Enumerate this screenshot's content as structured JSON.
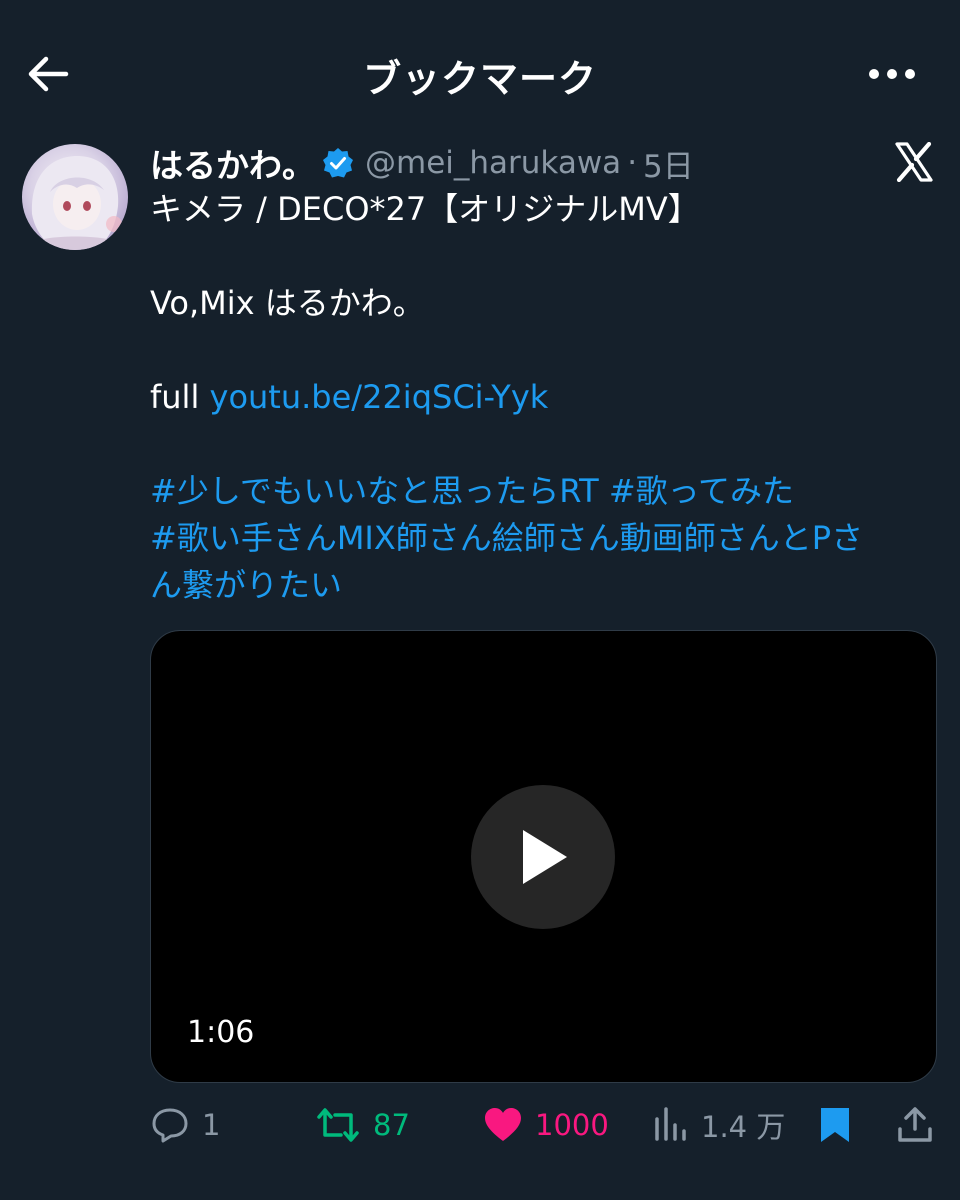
{
  "header": {
    "title": "ブックマーク"
  },
  "tweet": {
    "display_name": "はるかわ。",
    "handle": "@mei_harukawa",
    "separator": "·",
    "time": "5日",
    "lines": {
      "title": "キメラ / DECO*27【オリジナルMV】",
      "credits": "Vo,Mix はるかわ。",
      "full_prefix": "full ",
      "link": "youtu.be/22iqSCi-Yyk",
      "hashtag1": "#少しでもいいなと思ったらRT",
      "hashtag2": "#歌ってみた",
      "hashtag3_part1": "#歌い手さんMIX師さん絵師さん動画師さんとPさ",
      "hashtag3_part2": "ん繋がりたい"
    },
    "video": {
      "duration": "1:06"
    }
  },
  "actions": {
    "replies": "1",
    "retweets": "87",
    "likes": "1000",
    "views": "1.4 万"
  },
  "colors": {
    "background": "#15202b",
    "link": "#1d9bf0",
    "muted": "#8b98a5",
    "retweet": "#00ba7c",
    "like": "#f91880",
    "verified": "#1d9bf0"
  },
  "icons": {
    "back": "arrow-left-icon",
    "more": "more-horizontal-icon",
    "x": "x-logo-icon",
    "verified": "verified-badge-icon",
    "play": "play-icon",
    "reply": "reply-icon",
    "retweet": "retweet-icon",
    "like": "heart-icon",
    "views": "views-icon",
    "bookmark": "bookmark-icon",
    "share": "share-icon"
  }
}
